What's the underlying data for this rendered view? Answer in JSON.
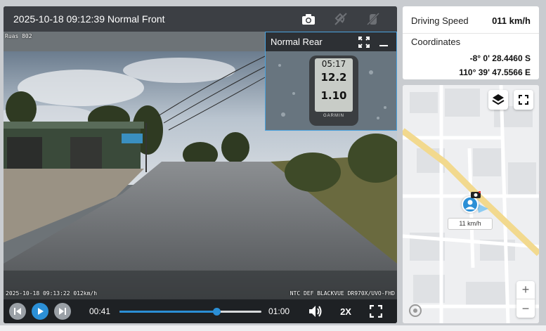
{
  "player": {
    "title": "2025-10-18 09:12:39 Normal Front",
    "overlay_top_left": "Ruas 802",
    "overlay_bottom_left": "2025-10-18 09:13:22 012km/h",
    "overlay_bottom_right": "NTC DEF BLACKVUE DR970X/UVO-FHD",
    "icons": [
      "camera-icon",
      "satellite-off-icon",
      "car-off-icon"
    ]
  },
  "rear": {
    "label": "Normal Rear",
    "gauge": {
      "time": "05:17",
      "speed": "12.2",
      "distance": "1.10",
      "brand": "GARMIN"
    }
  },
  "controls": {
    "current_time": "00:41",
    "duration": "01:00",
    "progress": 0.683,
    "speed_label": "2X"
  },
  "info": {
    "speed_label": "Driving Speed",
    "speed_value": "011 km/h",
    "coords_label": "Coordinates",
    "lat": "-8° 0' 28.4460 S",
    "lon": "110° 39' 47.5566 E"
  },
  "map": {
    "marker_speed": "11 km/h",
    "zoom_in": "+",
    "zoom_out": "−",
    "accent": "#2b8fd6",
    "road_color": "#f2d98e"
  }
}
